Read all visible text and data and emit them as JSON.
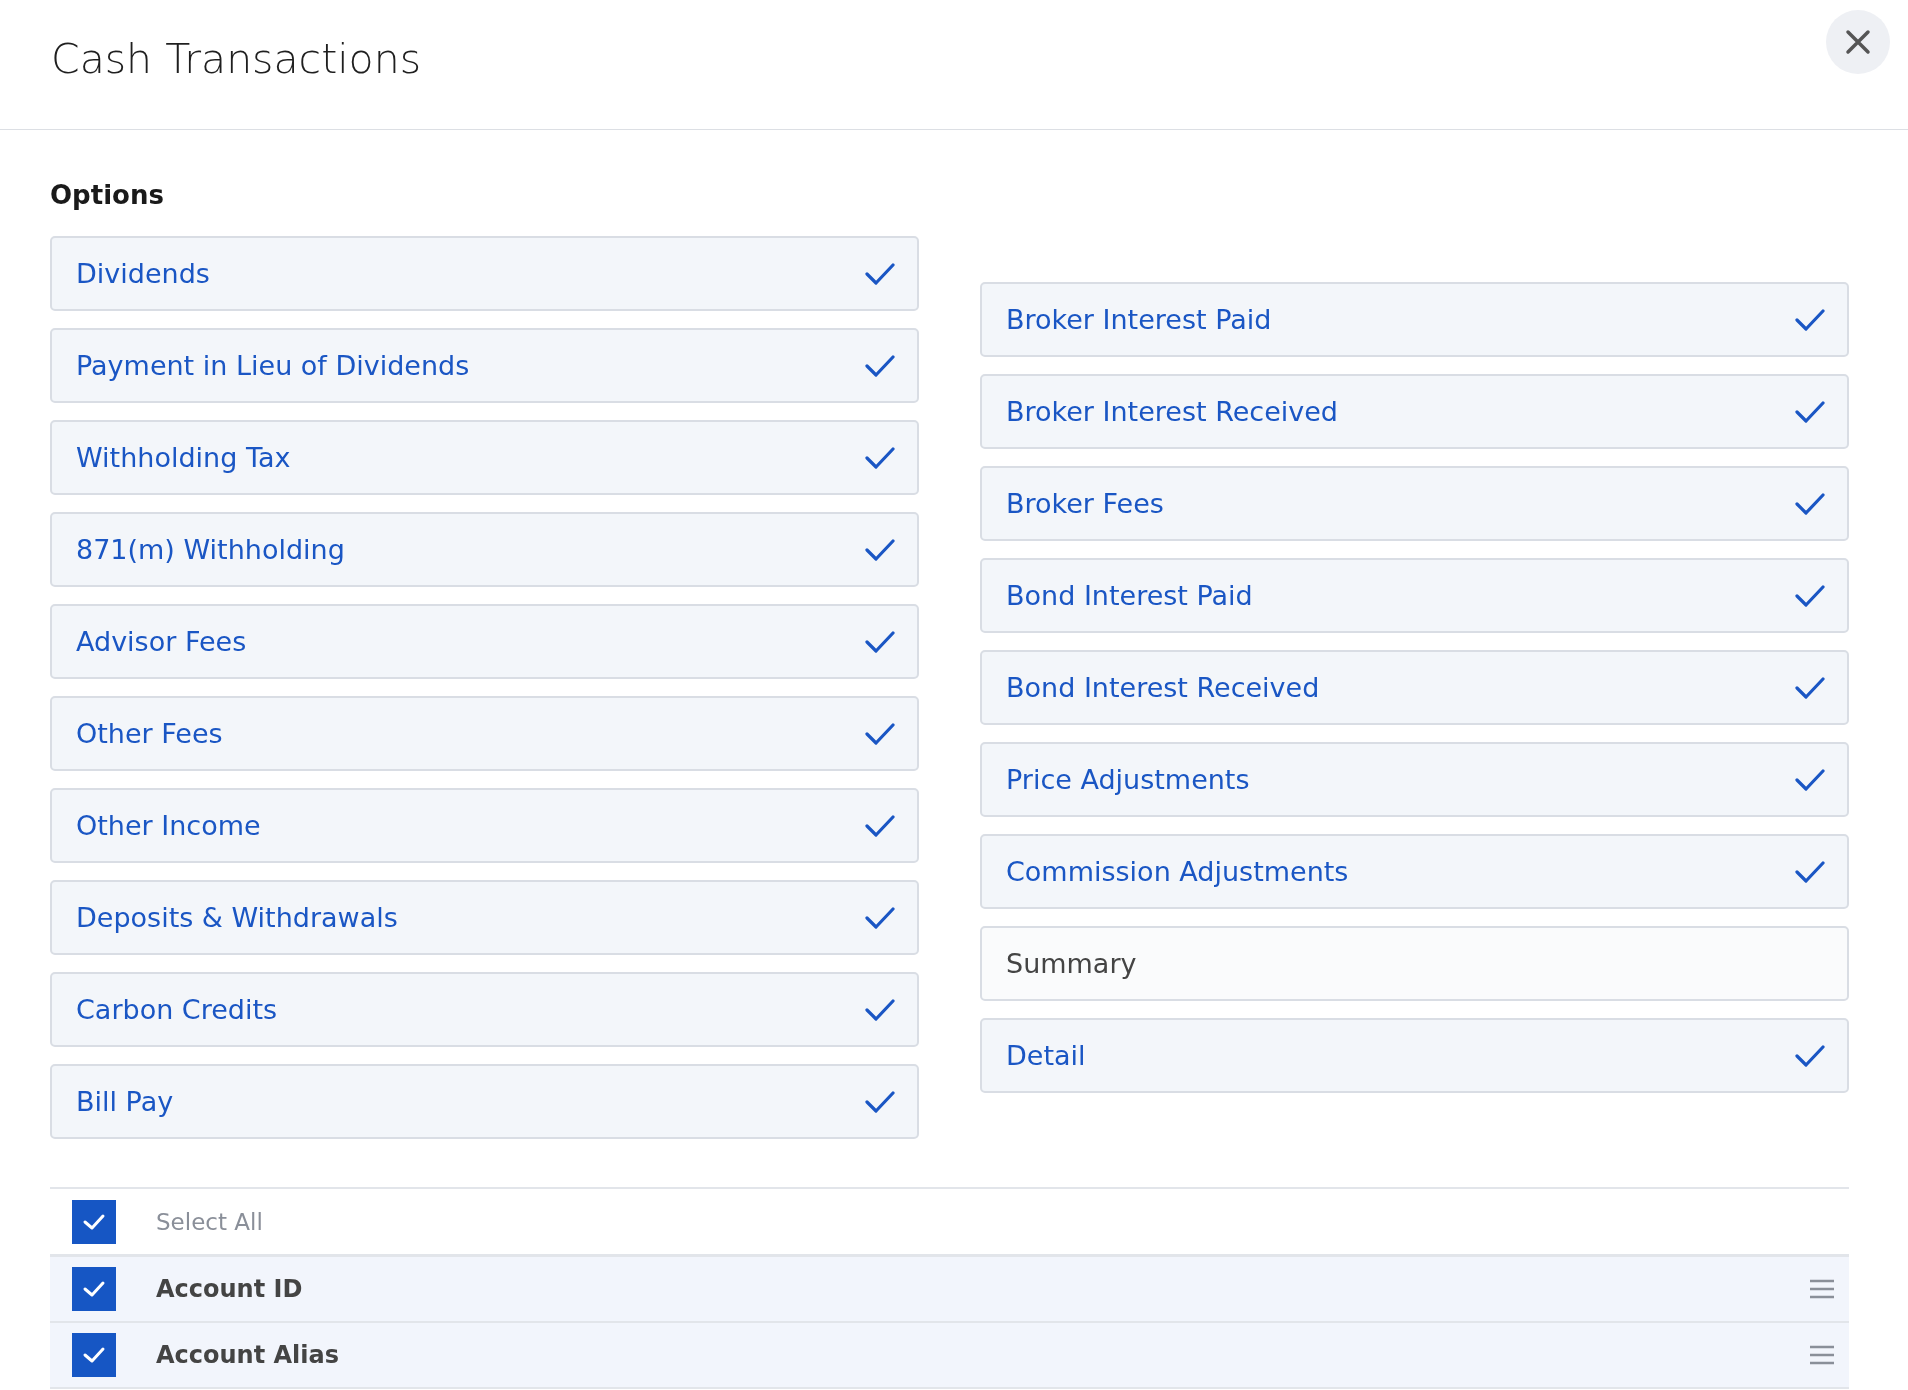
{
  "dialog": {
    "title": "Cash Transactions"
  },
  "options": {
    "heading": "Options",
    "left": [
      {
        "label": "Dividends",
        "checked": true
      },
      {
        "label": "Payment in Lieu of Dividends",
        "checked": true
      },
      {
        "label": "Withholding Tax",
        "checked": true
      },
      {
        "label": "871(m) Withholding",
        "checked": true
      },
      {
        "label": "Advisor Fees",
        "checked": true
      },
      {
        "label": "Other Fees",
        "checked": true
      },
      {
        "label": "Other Income",
        "checked": true
      },
      {
        "label": "Deposits & Withdrawals",
        "checked": true
      },
      {
        "label": "Carbon Credits",
        "checked": true
      },
      {
        "label": "Bill Pay",
        "checked": true
      }
    ],
    "right": [
      {
        "label": "Broker Interest Paid",
        "checked": true
      },
      {
        "label": "Broker Interest Received",
        "checked": true
      },
      {
        "label": "Broker Fees",
        "checked": true
      },
      {
        "label": "Bond Interest Paid",
        "checked": true
      },
      {
        "label": "Bond Interest Received",
        "checked": true
      },
      {
        "label": "Price Adjustments",
        "checked": true
      },
      {
        "label": "Commission Adjustments",
        "checked": true
      },
      {
        "label": "Summary",
        "checked": false
      },
      {
        "label": "Detail",
        "checked": true
      }
    ]
  },
  "fields": {
    "select_all": {
      "label": "Select All",
      "checked": true
    },
    "rows": [
      {
        "label": "Account ID",
        "checked": true
      },
      {
        "label": "Account Alias",
        "checked": true
      }
    ]
  }
}
